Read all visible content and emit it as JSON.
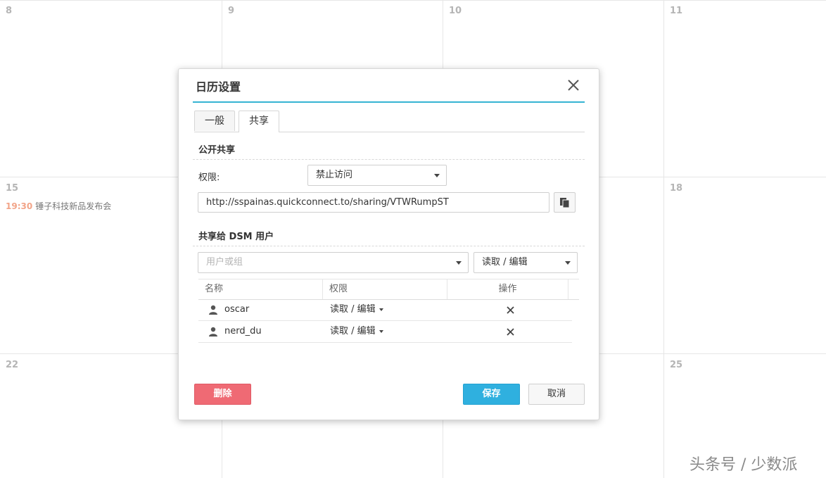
{
  "calendar": {
    "days": [
      {
        "num": "8"
      },
      {
        "num": "9"
      },
      {
        "num": "10"
      },
      {
        "num": "11"
      },
      {
        "num": "15"
      },
      {
        "num": ""
      },
      {
        "num": ""
      },
      {
        "num": "18"
      },
      {
        "num": "22"
      },
      {
        "num": ""
      },
      {
        "num": ""
      },
      {
        "num": "25"
      }
    ],
    "event": {
      "time": "19:30",
      "title": "锤子科技新品发布会"
    }
  },
  "dialog": {
    "title": "日历设置",
    "close_icon": "×",
    "tabs": [
      {
        "label": "一般",
        "active": false
      },
      {
        "label": "共享",
        "active": true
      }
    ],
    "public_share": {
      "section_title": "公开共享",
      "permission_label": "权限:",
      "permission_value": "禁止访问",
      "url": "http://sspainas.quickconnect.to/sharing/VTWRumpST",
      "copy_icon": "copy-icon"
    },
    "dsm_share": {
      "section_title": "共享给 DSM 用户",
      "user_placeholder": "用户或组",
      "permission_value": "读取 / 编辑",
      "columns": [
        "名称",
        "权限",
        "操作"
      ],
      "rows": [
        {
          "name": "oscar",
          "permission": "读取 / 编辑"
        },
        {
          "name": "nerd_du",
          "permission": "读取 / 编辑"
        }
      ]
    },
    "buttons": {
      "delete": "删除",
      "save": "保存",
      "cancel": "取消"
    }
  },
  "watermark": "头条号 / 少数派",
  "colors": {
    "accent": "#36b4d3",
    "save": "#2fb0df",
    "delete": "#ef6a74",
    "event_time": "#f2a488"
  }
}
